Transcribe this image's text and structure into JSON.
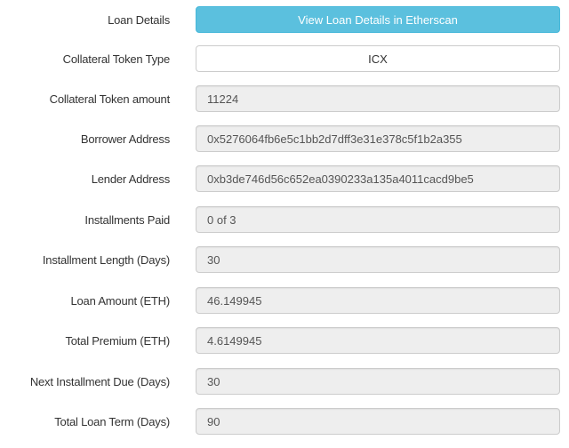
{
  "loan_details": {
    "label": "Loan Details",
    "button_label": "View Loan Details in Etherscan",
    "button_color": "#5bc0de"
  },
  "fields": [
    {
      "label": "Collateral Token Type",
      "value": "ICX"
    },
    {
      "label": "Collateral Token amount",
      "value": "11224"
    },
    {
      "label": "Borrower Address",
      "value": "0x5276064fb6e5c1bb2d7dff3e31e378c5f1b2a355"
    },
    {
      "label": "Lender Address",
      "value": "0xb3de746d56c652ea0390233a135a4011cacd9be5"
    },
    {
      "label": "Installments Paid",
      "value": "0 of 3"
    },
    {
      "label": "Installment Length (Days)",
      "value": "30"
    },
    {
      "label": "Loan Amount (ETH)",
      "value": "46.149945"
    },
    {
      "label": "Total Premium (ETH)",
      "value": "4.6149945"
    },
    {
      "label": "Next Installment Due (Days)",
      "value": "30"
    },
    {
      "label": "Total Loan Term (Days)",
      "value": "90"
    }
  ]
}
